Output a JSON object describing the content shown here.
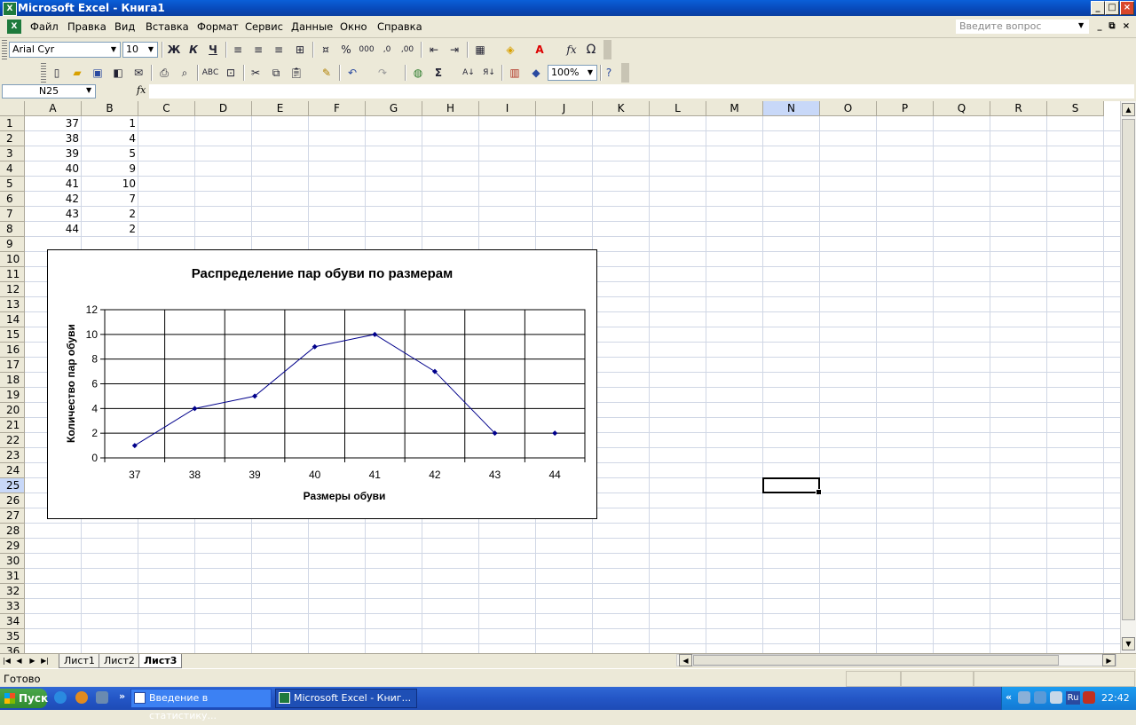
{
  "window": {
    "title": "Microsoft Excel - Книга1"
  },
  "menu": {
    "items": [
      "Файл",
      "Правка",
      "Вид",
      "Вставка",
      "Формат",
      "Сервис",
      "Данные",
      "Окно",
      "Справка"
    ],
    "ask_placeholder": "Введите вопрос"
  },
  "format_toolbar": {
    "font": "Arial Cyr",
    "size": "10",
    "bold": "Ж",
    "italic": "К",
    "underline": "Ч"
  },
  "standard_toolbar": {
    "zoom": "100%"
  },
  "formula_bar": {
    "name_box": "N25",
    "fx": "fx"
  },
  "grid": {
    "columns": [
      "A",
      "B",
      "C",
      "D",
      "E",
      "F",
      "G",
      "H",
      "I",
      "J",
      "K",
      "L",
      "M",
      "N",
      "O",
      "P",
      "Q",
      "R",
      "S"
    ],
    "rows": [
      "1",
      "2",
      "3",
      "4",
      "5",
      "6",
      "7",
      "8",
      "9",
      "10",
      "11",
      "12",
      "13",
      "14",
      "15",
      "16",
      "17",
      "18",
      "19",
      "20",
      "21",
      "22",
      "23",
      "24",
      "25",
      "26",
      "27",
      "28",
      "29",
      "30",
      "31",
      "32",
      "33",
      "34",
      "35",
      "36"
    ],
    "colA": [
      "37",
      "38",
      "39",
      "40",
      "41",
      "42",
      "43",
      "44"
    ],
    "colB": [
      "1",
      "4",
      "5",
      "9",
      "10",
      "7",
      "2",
      "2"
    ]
  },
  "chart_data": {
    "type": "line",
    "title": "Распределение пар обуви по размерам",
    "xlabel": "Размеры обуви",
    "ylabel": "Количество пар обуви",
    "categories": [
      "37",
      "38",
      "39",
      "40",
      "41",
      "42",
      "43",
      "44"
    ],
    "series": [
      {
        "values": [
          1,
          4,
          5,
          9,
          10,
          7,
          2,
          2
        ]
      }
    ],
    "ylim": [
      0,
      12
    ],
    "yticks": [
      "0",
      "2",
      "4",
      "6",
      "8",
      "10",
      "12"
    ],
    "grid": true,
    "color": "#00008b"
  },
  "sheets": {
    "tabs": [
      "Лист1",
      "Лист2",
      "Лист3"
    ],
    "active": "Лист3"
  },
  "status": {
    "text": "Готово"
  },
  "taskbar": {
    "start": "Пуск",
    "tasks": [
      "Введение в статистику...",
      "Microsoft Excel - Книг..."
    ],
    "lang": "Ru",
    "clock": "22:42"
  }
}
